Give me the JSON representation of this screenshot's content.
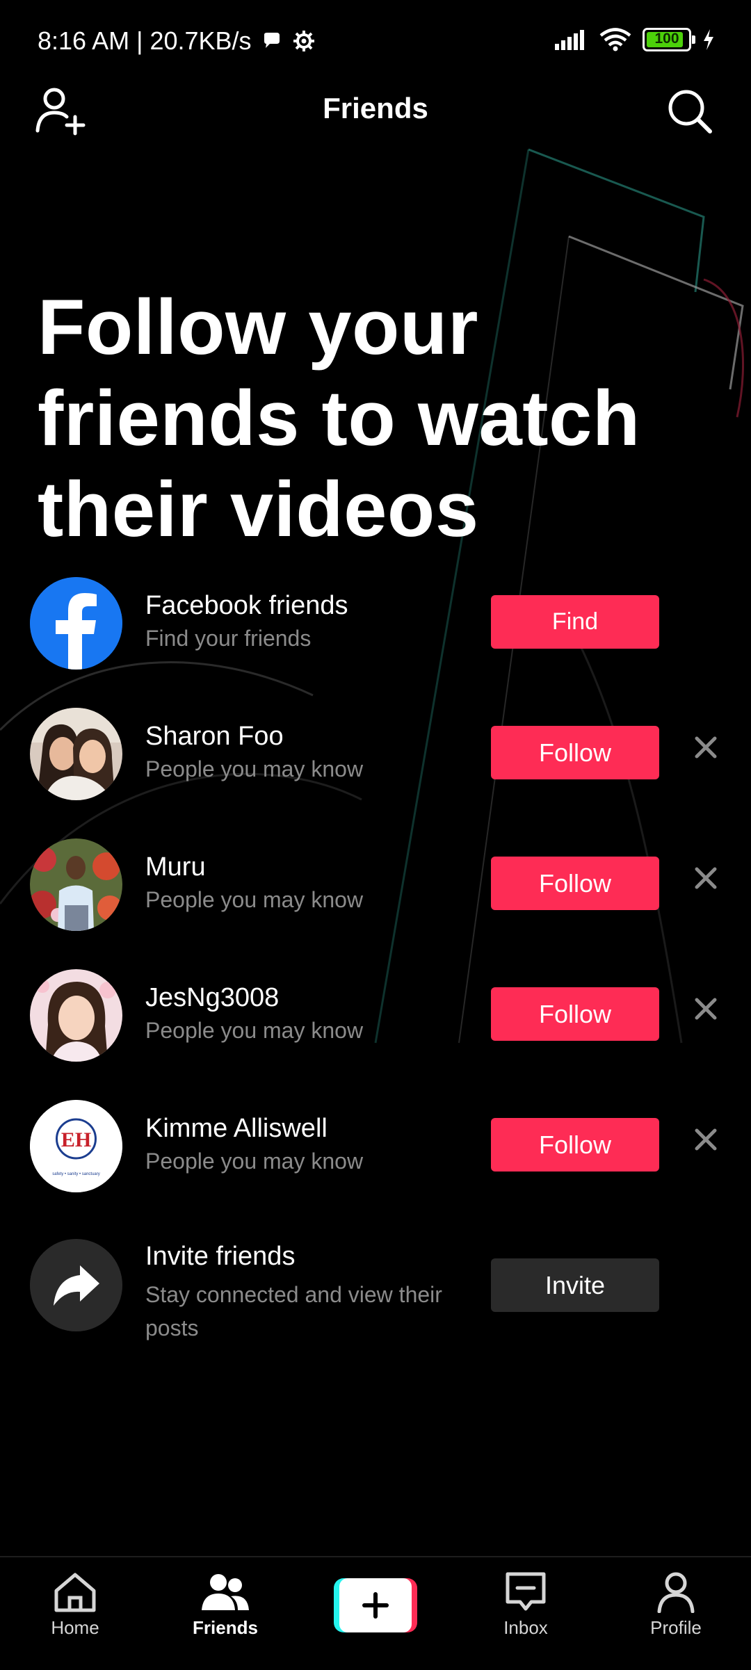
{
  "status_bar": {
    "time_speed": "8:16 AM | 20.7KB/s",
    "battery": "100",
    "icons": [
      "message-icon",
      "settings-icon",
      "signal-icon",
      "wifi-icon",
      "battery-icon",
      "charging-icon"
    ]
  },
  "header": {
    "title": "Friends",
    "left_icon": "add-person-icon",
    "right_icon": "search-icon"
  },
  "headline": "Follow your friends to watch their videos",
  "facebook": {
    "name": "Facebook friends",
    "subtitle": "Find your friends",
    "button": "Find",
    "color": "#1877f2"
  },
  "suggestions": [
    {
      "name": "Sharon Foo",
      "subtitle": "People you may know",
      "button": "Follow"
    },
    {
      "name": "Muru",
      "subtitle": "People you may know",
      "button": "Follow"
    },
    {
      "name": "JesNg3008",
      "subtitle": "People you may know",
      "button": "Follow"
    },
    {
      "name": "Kimme Alliswell",
      "subtitle": "People you may know",
      "button": "Follow",
      "avatar_logo": "EH",
      "avatar_caption": "safety • sanity • sanctuary"
    }
  ],
  "invite": {
    "name": "Invite friends",
    "subtitle": "Stay connected and view their posts",
    "button": "Invite"
  },
  "bottom_nav": {
    "home": "Home",
    "friends": "Friends",
    "inbox": "Inbox",
    "profile": "Profile",
    "active": "Friends"
  },
  "colors": {
    "accent": "#fe2c55",
    "cyan": "#25f4ee",
    "background": "#000000",
    "secondary_text": "#8b8b8b"
  }
}
